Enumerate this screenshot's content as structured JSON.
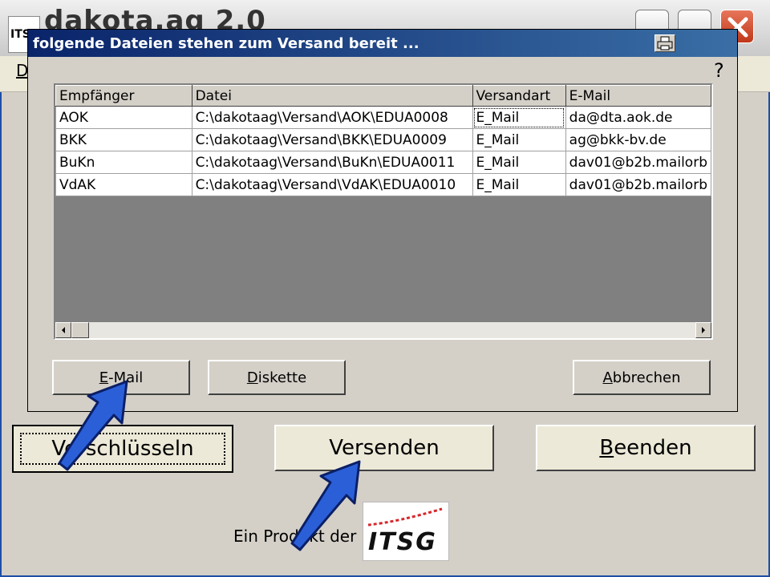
{
  "main": {
    "title": "dakota.ag 2.0",
    "menu_first": "D",
    "logo_text": "ITS",
    "buttons": {
      "verschluesseln": "Verschlüsseln",
      "versenden": "Versenden",
      "beenden_prefix": "B",
      "beenden_rest": "eenden"
    },
    "footer_text": "Ein Produkt der",
    "itsg_logo_text": "ITSG"
  },
  "dialog": {
    "title": "folgende Dateien stehen zum Versand bereit ...",
    "help": "?",
    "columns": [
      "Empfänger",
      "Datei",
      "Versandart",
      "E-Mail"
    ],
    "rows": [
      [
        "AOK",
        "C:\\dakotaag\\Versand\\AOK\\EDUA0008",
        "E_Mail",
        "da@dta.aok.de"
      ],
      [
        "BKK",
        "C:\\dakotaag\\Versand\\BKK\\EDUA0009",
        "E_Mail",
        "ag@bkk-bv.de"
      ],
      [
        "BuKn",
        "C:\\dakotaag\\Versand\\BuKn\\EDUA0011",
        "E_Mail",
        "dav01@b2b.mailorb"
      ],
      [
        "VdAK",
        "C:\\dakotaag\\Versand\\VdAK\\EDUA0010",
        "E_Mail",
        "dav01@b2b.mailorb"
      ]
    ],
    "buttons": {
      "email_prefix": "E",
      "email_rest": "-Mail",
      "diskette_prefix": "D",
      "diskette_rest": "iskette",
      "abbrechen_prefix": "A",
      "abbrechen_rest": "bbrechen"
    }
  },
  "colors": {
    "dialog_title_start": "#0a246a",
    "dialog_title_end": "#3a6ea5",
    "arrow_fill": "#2a5fd8",
    "close_button": "#c0381a"
  }
}
